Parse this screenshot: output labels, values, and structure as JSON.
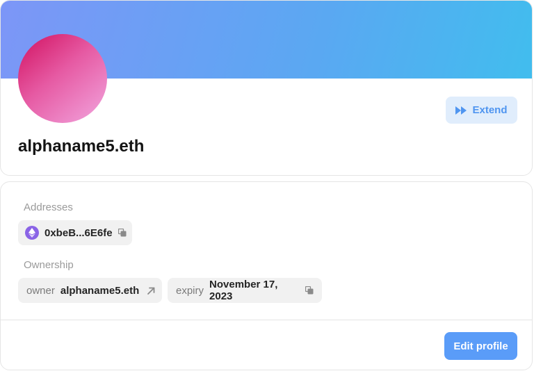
{
  "profile": {
    "name": "alphaname5.eth",
    "extend_label": "Extend",
    "colors": {
      "banner_start": "#7d96f7",
      "banner_end": "#41bdee",
      "avatar_start": "#d1105f",
      "avatar_end": "#f2a6df"
    }
  },
  "details": {
    "addresses_label": "Addresses",
    "address": {
      "icon": "ethereum-icon",
      "value": "0xbeB...6E6fe",
      "action_icon": "copy-icon"
    },
    "ownership_label": "Ownership",
    "owner": {
      "key": "owner",
      "value": "alphaname5.eth",
      "action_icon": "external-link-arrow-icon"
    },
    "expiry": {
      "key": "expiry",
      "value": "November 17, 2023",
      "action_icon": "copy-icon"
    },
    "edit_label": "Edit profile"
  },
  "theme": {
    "accent": "#5a9cf8",
    "accent_soft": "#e0edfc",
    "ethereum": "#8a63e6"
  }
}
